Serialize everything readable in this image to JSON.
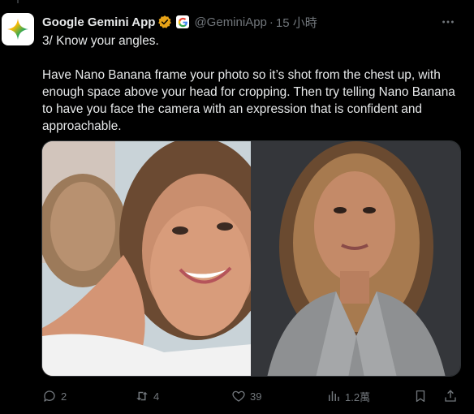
{
  "tweet": {
    "author_name": "Google Gemini App",
    "handle": "@GeminiApp",
    "separator": "·",
    "time": "15 小時",
    "text_line1": "3/ Know your angles.",
    "text_para2": "Have Nano Banana frame your photo so it’s shot from the chest up, with enough space above your head for cropping. Then try telling Nano Banana to have you face the camera with an expression that is confident and approachable."
  },
  "actions": {
    "replies": "2",
    "reposts": "4",
    "likes": "39",
    "views": "1.2萬"
  },
  "media": {
    "left_image": "selfie-photo",
    "right_image": "professional-headshot"
  },
  "colors": {
    "background": "#000000",
    "text": "#e7e9ea",
    "secondary_text": "#71767b",
    "verified_badge": "#e8a317",
    "border": "#2f3336"
  }
}
